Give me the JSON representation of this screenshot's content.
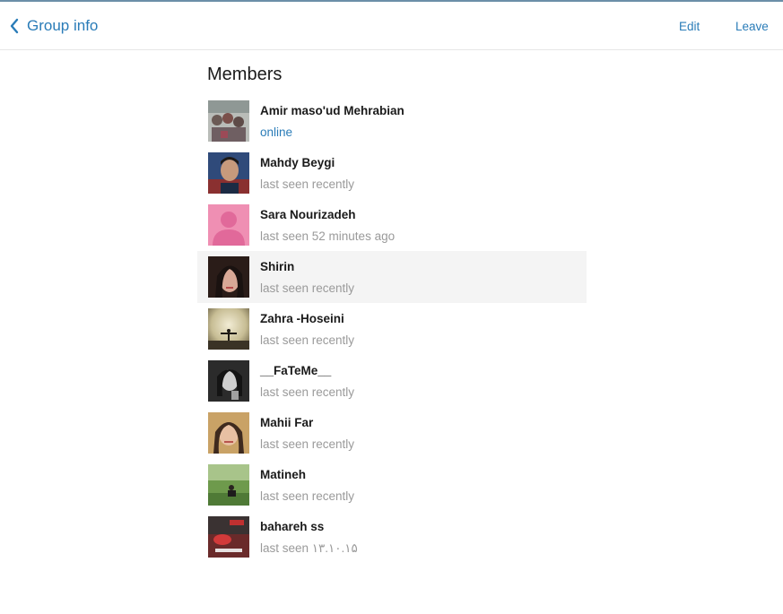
{
  "header": {
    "back_label": "Group info",
    "edit_label": "Edit",
    "leave_label": "Leave"
  },
  "colors": {
    "accent": "#2a7cb8",
    "status_gray": "#9a9a9a",
    "highlight_row": "#f4f4f4"
  },
  "members_title": "Members",
  "members": [
    {
      "name": "Amir maso'ud Mehrabian",
      "status": "online"
    },
    {
      "name": "Mahdy Beygi",
      "status": "last seen recently"
    },
    {
      "name": "Sara Nourizadeh",
      "status": "last seen 52 minutes ago"
    },
    {
      "name": "Shirin",
      "status": "last seen recently"
    },
    {
      "name": "Zahra -Hoseini",
      "status": "last seen recently"
    },
    {
      "name": "__FaTeMe__",
      "status": "last seen recently"
    },
    {
      "name": "Mahii Far",
      "status": "last seen recently"
    },
    {
      "name": "Matineh",
      "status": "last seen recently"
    },
    {
      "name": "bahareh ss",
      "status": "last seen ۱۳.۱۰.۱۵"
    }
  ]
}
